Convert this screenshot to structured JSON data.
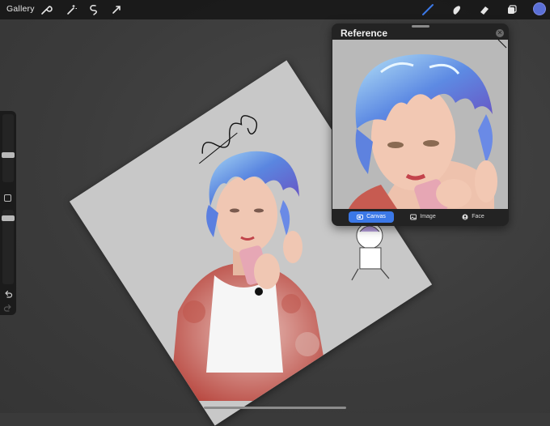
{
  "toolbar": {
    "gallery_label": "Gallery",
    "left_tools": [
      "wrench-icon",
      "magic-wand-icon",
      "selection-icon",
      "transform-icon"
    ],
    "right_tools": [
      "brush-icon",
      "smudge-icon",
      "eraser-icon",
      "layers-icon"
    ],
    "active_tool": "brush-icon",
    "accent_color": "#3b78e7",
    "current_color": "#5a6fd6"
  },
  "sidebar": {
    "brush_size_level": 0.55,
    "opacity_level": 0.92,
    "controls": [
      "modify-button",
      "undo-icon",
      "redo-icon"
    ]
  },
  "canvas": {
    "artwork": "digital-illustration",
    "signature_text": "Helenaconal"
  },
  "reference": {
    "title": "Reference",
    "tabs": [
      {
        "label": "Canvas",
        "icon": "canvas-icon",
        "active": true
      },
      {
        "label": "Image",
        "icon": "image-icon",
        "active": false
      },
      {
        "label": "Face",
        "icon": "face-icon",
        "active": false
      }
    ]
  }
}
